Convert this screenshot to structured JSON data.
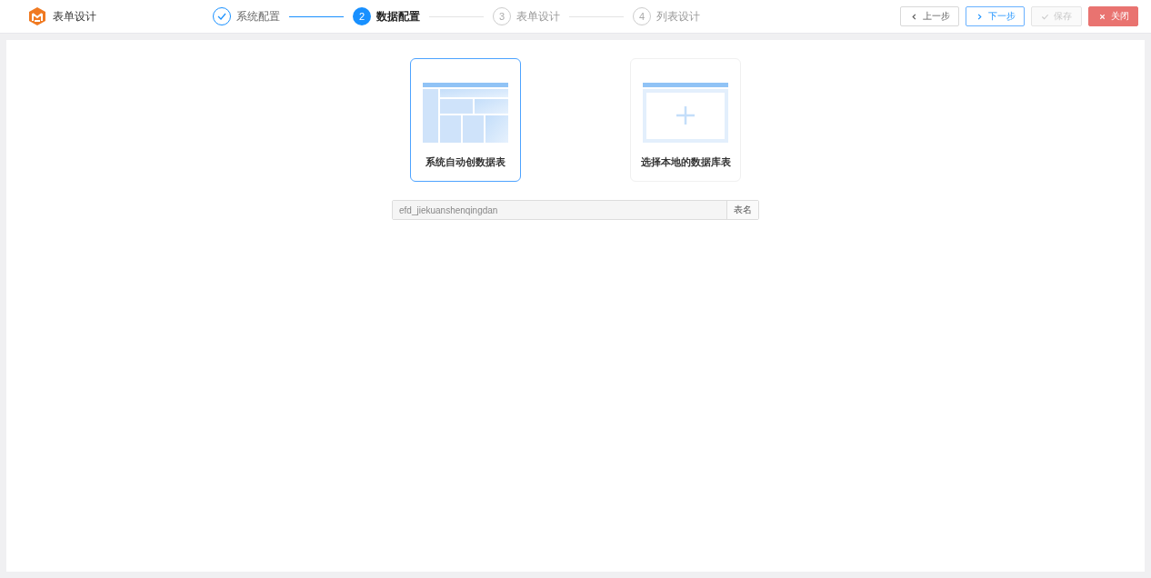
{
  "app": {
    "title": "表单设计"
  },
  "steps": [
    {
      "label": "系统配置",
      "completed": true,
      "selected": false
    },
    {
      "number": "2",
      "label": "数据配置",
      "completed": false,
      "selected": true
    },
    {
      "number": "3",
      "label": "表单设计",
      "completed": false,
      "selected": false
    },
    {
      "number": "4",
      "label": "列表设计",
      "completed": false,
      "selected": false
    }
  ],
  "toolbar": [
    {
      "label": "上一步",
      "kind": "prev",
      "disabled": false
    },
    {
      "label": "下一步",
      "kind": "next",
      "disabled": false
    },
    {
      "label": "保存",
      "kind": "save",
      "disabled": true
    },
    {
      "label": "关闭",
      "kind": "close",
      "disabled": false
    }
  ],
  "options": [
    {
      "label": "系统自动创数据表",
      "kind": "grid",
      "selected": true
    },
    {
      "label": "选择本地的数据库表",
      "kind": "plus",
      "selected": false
    }
  ],
  "table_name": {
    "value": "efd_jiekuanshenqingdan",
    "addon": "表名",
    "disabled": true
  }
}
